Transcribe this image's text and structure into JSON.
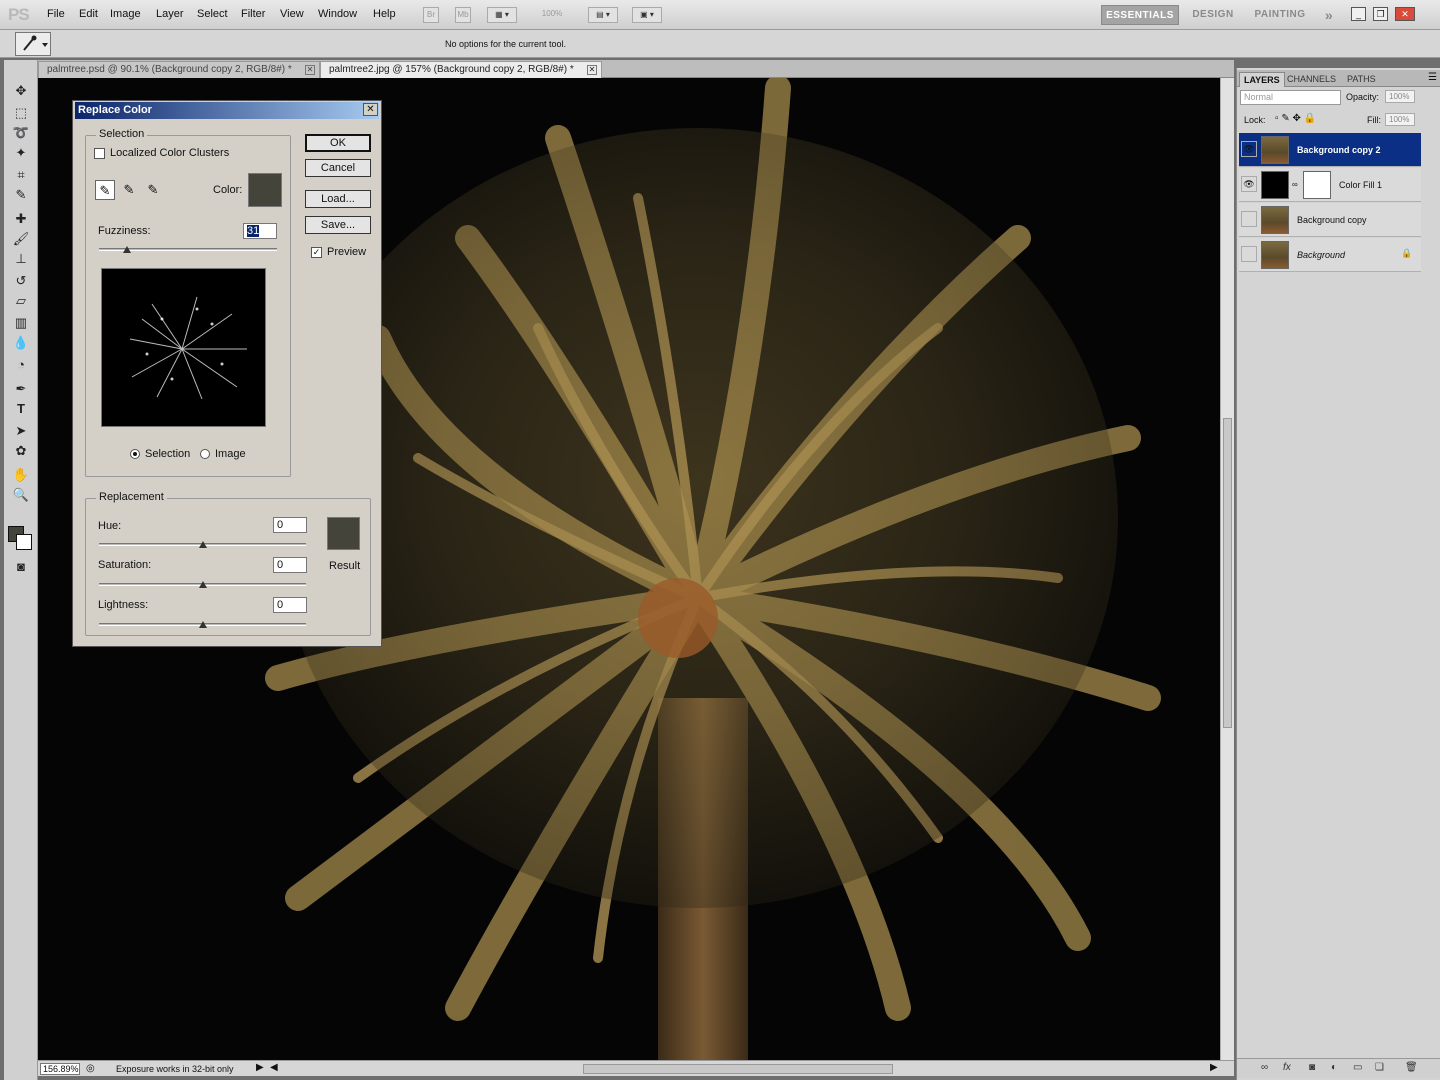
{
  "menubar": {
    "logo": "PS",
    "items": [
      "File",
      "Edit",
      "Image",
      "Layer",
      "Select",
      "Filter",
      "View",
      "Window",
      "Help"
    ],
    "bridge": "Br",
    "minibridge": "Mb",
    "zoom": "100%",
    "workspaces": [
      "ESSENTIALS",
      "DESIGN",
      "PAINTING"
    ],
    "more": "»"
  },
  "options": {
    "message": "No options for the current tool."
  },
  "tabs": [
    {
      "label": "palmtree.psd @ 90.1% (Background copy 2, RGB/8#) *"
    },
    {
      "label": "palmtree2.jpg @ 157% (Background copy 2, RGB/8#) *"
    }
  ],
  "status": {
    "zoom": "156.89%",
    "text": "Exposure works in 32-bit only"
  },
  "layers_panel": {
    "tabs": [
      "LAYERS",
      "CHANNELS",
      "PATHS"
    ],
    "blend_mode": "Normal",
    "opacity_label": "Opacity:",
    "opacity": "100%",
    "lock_label": "Lock:",
    "fill_label": "Fill:",
    "fill": "100%",
    "layers": [
      {
        "name": "Background copy 2",
        "visible": true,
        "selected": true
      },
      {
        "name": "Color Fill 1",
        "visible": true,
        "selected": false
      },
      {
        "name": "Background copy",
        "visible": false,
        "selected": false
      },
      {
        "name": "Background",
        "visible": false,
        "selected": false,
        "locked": true
      }
    ]
  },
  "dialog": {
    "title": "Replace Color",
    "selection_group": "Selection",
    "localized_label": "Localized Color Clusters",
    "color_label": "Color:",
    "color": "#44443a",
    "fuzziness_label": "Fuzziness:",
    "fuzziness": "31",
    "fuzziness_fraction": 0.155,
    "radio_selection": "Selection",
    "radio_image": "Image",
    "replacement_group": "Replacement",
    "hue_label": "Hue:",
    "hue": "0",
    "saturation_label": "Saturation:",
    "saturation": "0",
    "lightness_label": "Lightness:",
    "lightness": "0",
    "result_label": "Result",
    "result_color": "#44443a",
    "ok": "OK",
    "cancel": "Cancel",
    "load": "Load...",
    "save": "Save...",
    "preview_label": "Preview",
    "preview_checked": true
  },
  "colors": {
    "foreground": "#44443a",
    "background": "#ffffff",
    "selected_layer": "#0a2f84"
  }
}
